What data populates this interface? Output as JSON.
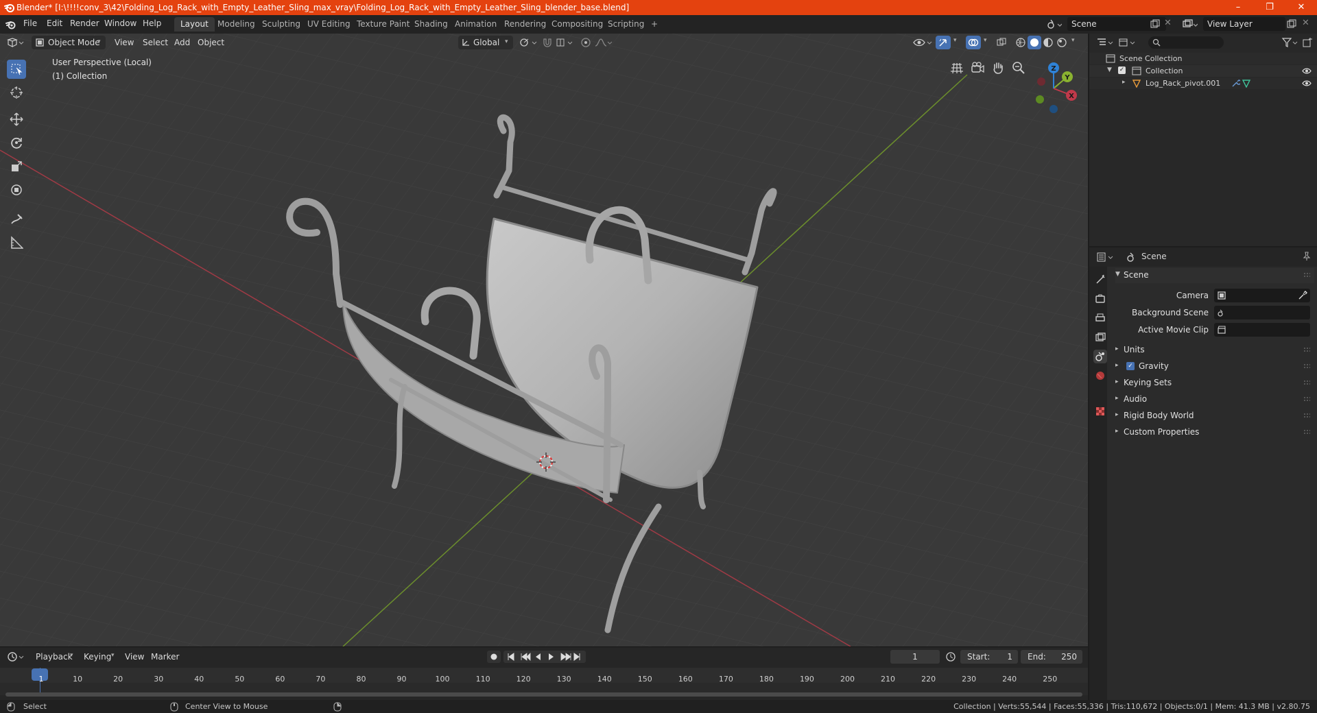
{
  "window": {
    "title": "Blender* [I:\\!!!!conv_3\\42\\Folding_Log_Rack_with_Empty_Leather_Sling_max_vray\\Folding_Log_Rack_with_Empty_Leather_Sling_blender_base.blend]",
    "controls": [
      "–",
      "❐",
      "✕"
    ]
  },
  "menu": [
    "File",
    "Edit",
    "Render",
    "Window",
    "Help"
  ],
  "workspaces": [
    "Layout",
    "Modeling",
    "Sculpting",
    "UV Editing",
    "Texture Paint",
    "Shading",
    "Animation",
    "Rendering",
    "Compositing",
    "Scripting",
    "+"
  ],
  "scene_field": "Scene",
  "view_layer_field": "View Layer",
  "viewport": {
    "mode": "Object Mode",
    "menus": [
      "View",
      "Select",
      "Add",
      "Object"
    ],
    "transform_orientation": "Global",
    "overlay_line1": "User Perspective (Local)",
    "overlay_line2": "(1) Collection",
    "gizmo_axes": {
      "x": "X",
      "y": "Y",
      "z": "Z"
    },
    "colors": {
      "x_axis": "#c0394a",
      "y_axis": "#8ab230",
      "z_axis": "#2f82d6",
      "background": "#393939"
    }
  },
  "tools": [
    "select-box-icon",
    "cursor-icon",
    "move-icon",
    "rotate-icon",
    "scale-icon",
    "transform-icon",
    "annotate-icon",
    "measure-icon"
  ],
  "timeline": {
    "menus": [
      "Playback",
      "Keying",
      "View",
      "Marker"
    ],
    "current_frame": "1",
    "start_label": "Start:",
    "start": "1",
    "end_label": "End:",
    "end": "250",
    "ruler": [
      "1",
      "10",
      "20",
      "30",
      "40",
      "50",
      "60",
      "70",
      "80",
      "90",
      "100",
      "110",
      "120",
      "130",
      "140",
      "150",
      "160",
      "170",
      "180",
      "190",
      "200",
      "210",
      "220",
      "230",
      "240",
      "250"
    ]
  },
  "status": {
    "left_action": "Select",
    "mid_action": "Center View to Mouse",
    "stats": "Collection | Verts:55,544 | Faces:55,336 | Tris:110,672 | Objects:0/1 | Mem: 41.3 MB | v2.80.75"
  },
  "outliner": {
    "root": "Scene Collection",
    "collection": "Collection",
    "object": "Log_Rack_pivot.001"
  },
  "properties": {
    "header": "Scene",
    "panel_title": "Scene",
    "fields": [
      {
        "label": "Camera"
      },
      {
        "label": "Background Scene"
      },
      {
        "label": "Active Movie Clip"
      }
    ],
    "panels": [
      "Units",
      "Gravity",
      "Keying Sets",
      "Audio",
      "Rigid Body World",
      "Custom Properties"
    ]
  }
}
